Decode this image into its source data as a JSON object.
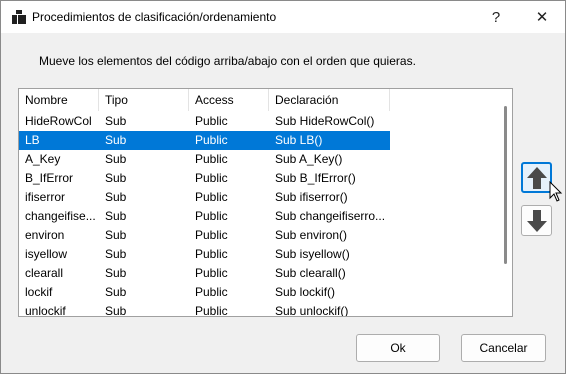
{
  "window": {
    "title": "Procedimientos de clasificación/ordenamiento",
    "help_label": "?",
    "close_label": "✕"
  },
  "instructions": "Mueve los elementos del código arriba/abajo con el orden que quieras.",
  "table": {
    "columns": [
      "Nombre",
      "Tipo",
      "Access",
      "Declaración"
    ],
    "selected_index": 1,
    "rows": [
      [
        "HideRowCol",
        "Sub",
        "Public",
        "Sub HideRowCol()"
      ],
      [
        "LB",
        "Sub",
        "Public",
        "Sub LB()"
      ],
      [
        "A_Key",
        "Sub",
        "Public",
        "Sub A_Key()"
      ],
      [
        "B_IfError",
        "Sub",
        "Public",
        "Sub B_IfError()"
      ],
      [
        "ifiserror",
        "Sub",
        "Public",
        "Sub ifiserror()"
      ],
      [
        "changeifise...",
        "Sub",
        "Public",
        "Sub changeifiserro..."
      ],
      [
        "environ",
        "Sub",
        "Public",
        "Sub environ()"
      ],
      [
        "isyellow",
        "Sub",
        "Public",
        "Sub isyellow()"
      ],
      [
        "clearall",
        "Sub",
        "Public",
        "Sub clearall()"
      ],
      [
        "lockif",
        "Sub",
        "Public",
        "Sub lockif()"
      ],
      [
        "unlockif",
        "Sub",
        "Public",
        "Sub unlockif()"
      ]
    ]
  },
  "buttons": {
    "ok": "Ok",
    "cancel": "Cancelar"
  },
  "icons": {
    "move_up": "arrow-up-icon",
    "move_down": "arrow-down-icon"
  },
  "colors": {
    "selection": "#0078d7",
    "arrow": "#4a4a4a"
  }
}
